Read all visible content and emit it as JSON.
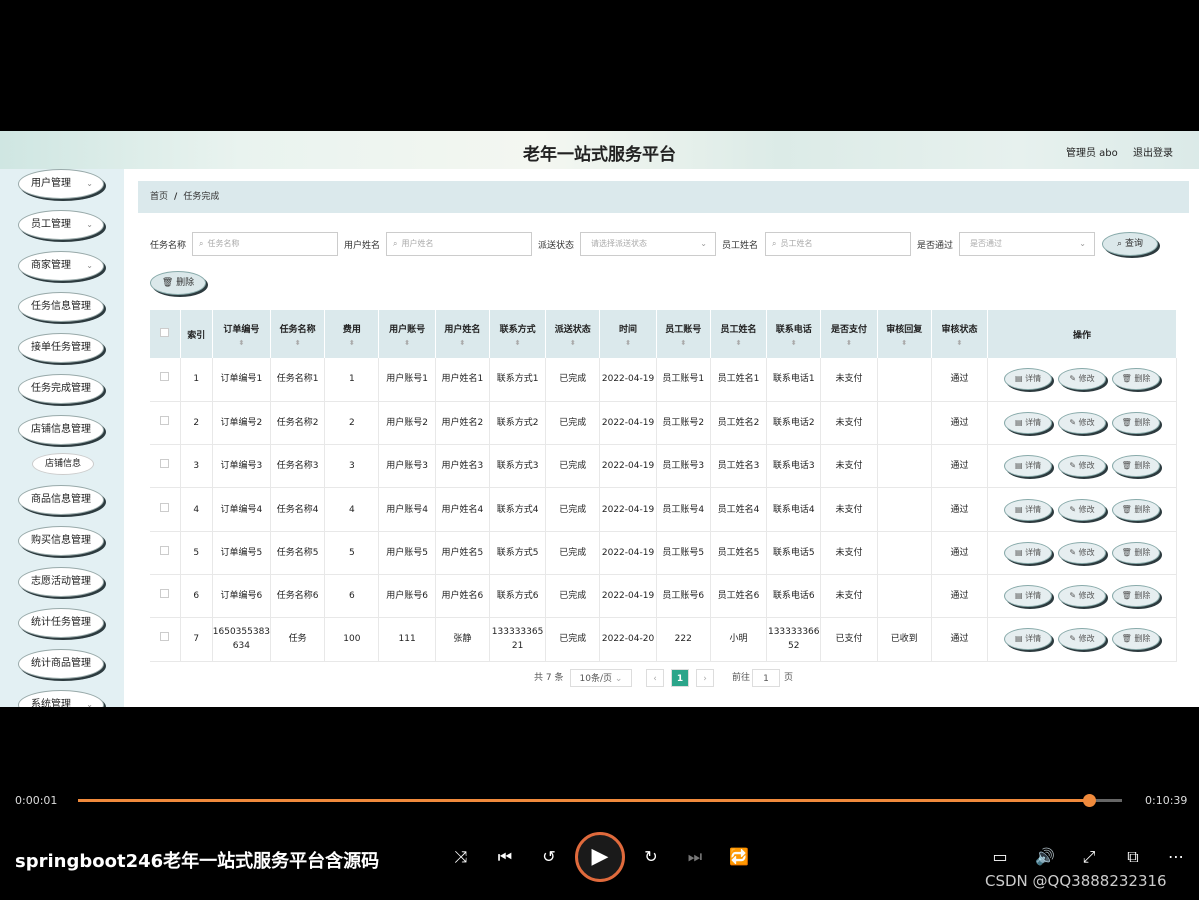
{
  "app": {
    "title": "老年一站式服务平台",
    "admin": "管理员 abo",
    "logout": "退出登录"
  },
  "sidebar": {
    "items": [
      {
        "label": "用户管理",
        "chevron": true
      },
      {
        "label": "员工管理",
        "chevron": true
      },
      {
        "label": "商家管理",
        "chevron": true
      },
      {
        "label": "任务信息管理",
        "chevron": false
      },
      {
        "label": "接单任务管理",
        "chevron": false
      },
      {
        "label": "任务完成管理",
        "chevron": false
      },
      {
        "label": "店铺信息管理",
        "chevron": false
      },
      {
        "label": "商品信息管理",
        "chevron": false
      },
      {
        "label": "购买信息管理",
        "chevron": false
      },
      {
        "label": "志愿活动管理",
        "chevron": false
      },
      {
        "label": "统计任务管理",
        "chevron": false
      },
      {
        "label": "统计商品管理",
        "chevron": false
      },
      {
        "label": "系统管理",
        "chevron": true
      }
    ],
    "submenu": "店铺信息"
  },
  "breadcrumb": {
    "home": "首页",
    "current": "任务完成"
  },
  "filters": {
    "task_name": {
      "label": "任务名称",
      "placeholder": "任务名称"
    },
    "user_name": {
      "label": "用户姓名",
      "placeholder": "用户姓名"
    },
    "dispatch": {
      "label": "派送状态",
      "placeholder": "请选择派送状态"
    },
    "staff_name": {
      "label": "员工姓名",
      "placeholder": "员工姓名"
    },
    "approved": {
      "label": "是否通过",
      "placeholder": "是否通过"
    },
    "query_btn": "查询",
    "delete_btn": "删除"
  },
  "table": {
    "headers": [
      "索引",
      "订单编号",
      "任务名称",
      "费用",
      "用户账号",
      "用户姓名",
      "联系方式",
      "派送状态",
      "时间",
      "员工账号",
      "员工姓名",
      "联系电话",
      "是否支付",
      "审核回复",
      "审核状态",
      "操作"
    ],
    "rows": [
      [
        "1",
        "订单编号1",
        "任务名称1",
        "1",
        "用户账号1",
        "用户姓名1",
        "联系方式1",
        "已完成",
        "2022-04-19",
        "员工账号1",
        "员工姓名1",
        "联系电话1",
        "未支付",
        "",
        "通过"
      ],
      [
        "2",
        "订单编号2",
        "任务名称2",
        "2",
        "用户账号2",
        "用户姓名2",
        "联系方式2",
        "已完成",
        "2022-04-19",
        "员工账号2",
        "员工姓名2",
        "联系电话2",
        "未支付",
        "",
        "通过"
      ],
      [
        "3",
        "订单编号3",
        "任务名称3",
        "3",
        "用户账号3",
        "用户姓名3",
        "联系方式3",
        "已完成",
        "2022-04-19",
        "员工账号3",
        "员工姓名3",
        "联系电话3",
        "未支付",
        "",
        "通过"
      ],
      [
        "4",
        "订单编号4",
        "任务名称4",
        "4",
        "用户账号4",
        "用户姓名4",
        "联系方式4",
        "已完成",
        "2022-04-19",
        "员工账号4",
        "员工姓名4",
        "联系电话4",
        "未支付",
        "",
        "通过"
      ],
      [
        "5",
        "订单编号5",
        "任务名称5",
        "5",
        "用户账号5",
        "用户姓名5",
        "联系方式5",
        "已完成",
        "2022-04-19",
        "员工账号5",
        "员工姓名5",
        "联系电话5",
        "未支付",
        "",
        "通过"
      ],
      [
        "6",
        "订单编号6",
        "任务名称6",
        "6",
        "用户账号6",
        "用户姓名6",
        "联系方式6",
        "已完成",
        "2022-04-19",
        "员工账号6",
        "员工姓名6",
        "联系电话6",
        "未支付",
        "",
        "通过"
      ],
      [
        "7",
        "1650355383634",
        "任务",
        "100",
        "111",
        "张静",
        "13333336521",
        "已完成",
        "2022-04-20",
        "222",
        "小明",
        "13333336652",
        "已支付",
        "已收到",
        "通过"
      ]
    ],
    "actions": {
      "detail": "详情",
      "edit": "修改",
      "delete": "删除"
    }
  },
  "pager": {
    "total": "共 7 条",
    "page_size": "10条/页",
    "page": "1",
    "goto": "前往",
    "goto_value": "1",
    "page_suffix": "页"
  },
  "player": {
    "current": "0:00:01",
    "duration": "0:10:39",
    "progress": 0.997,
    "title": "springboot246老年一站式服务平台含源码",
    "watermark": "CSDN @QQ3888232316",
    "accent": "#f08a3c"
  }
}
